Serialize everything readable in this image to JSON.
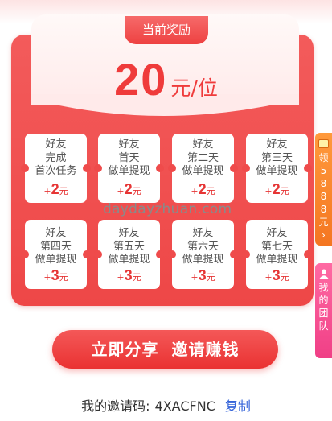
{
  "header": {
    "tab_label": "当前奖励"
  },
  "reward": {
    "amount": "20",
    "unit": "元/位"
  },
  "cards": [
    {
      "lines": [
        "好友",
        "完成",
        "首次任务"
      ],
      "bonus_prefix": "+",
      "bonus_value": "2",
      "bonus_unit": "元"
    },
    {
      "lines": [
        "好友",
        "首天",
        "做单提现"
      ],
      "bonus_prefix": "+",
      "bonus_value": "2",
      "bonus_unit": "元"
    },
    {
      "lines": [
        "好友",
        "第二天",
        "做单提现"
      ],
      "bonus_prefix": "+",
      "bonus_value": "2",
      "bonus_unit": "元"
    },
    {
      "lines": [
        "好友",
        "第三天",
        "做单提现"
      ],
      "bonus_prefix": "+",
      "bonus_value": "2",
      "bonus_unit": "元"
    },
    {
      "lines": [
        "好友",
        "第四天",
        "做单提现"
      ],
      "bonus_prefix": "+",
      "bonus_value": "3",
      "bonus_unit": "元"
    },
    {
      "lines": [
        "好友",
        "第五天",
        "做单提现"
      ],
      "bonus_prefix": "+",
      "bonus_value": "3",
      "bonus_unit": "元"
    },
    {
      "lines": [
        "好友",
        "第六天",
        "做单提现"
      ],
      "bonus_prefix": "+",
      "bonus_value": "3",
      "bonus_unit": "元"
    },
    {
      "lines": [
        "好友",
        "第七天",
        "做单提现"
      ],
      "bonus_prefix": "+",
      "bonus_value": "3",
      "bonus_unit": "元"
    }
  ],
  "watermark": "daydayzhuan.com",
  "side_tabs": {
    "claim": {
      "chars": [
        "领",
        "5",
        "8",
        "8",
        "8",
        "元"
      ],
      "arrow": "›",
      "icon": "gift-icon"
    },
    "team": {
      "chars": [
        "我",
        "的",
        "团",
        "队"
      ],
      "icon": "people-icon"
    }
  },
  "cta": {
    "left": "立即分享",
    "right": "邀请赚钱"
  },
  "invite": {
    "label": "我的邀请码:",
    "code": "4XACFNC",
    "copy_label": "复制"
  },
  "colors": {
    "accent_red": "#ee4747",
    "orange_tab": "#f47621",
    "pink_tab": "#f03f86",
    "link_blue": "#3564d9"
  }
}
